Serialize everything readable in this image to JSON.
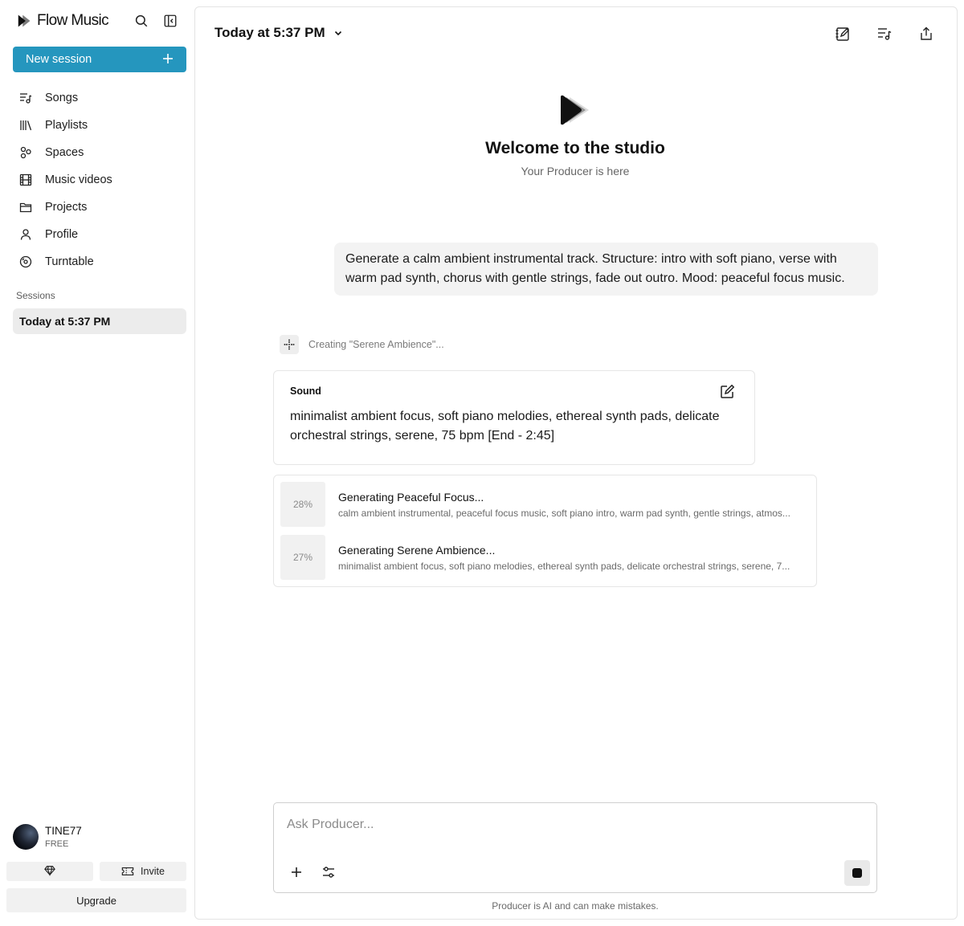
{
  "app": {
    "name": "Flow Music"
  },
  "sidebar": {
    "new_session_label": "New session",
    "new_session_icon": "plus-icon",
    "items": [
      {
        "label": "Songs",
        "icon": "songs-icon"
      },
      {
        "label": "Playlists",
        "icon": "library-icon"
      },
      {
        "label": "Spaces",
        "icon": "spaces-icon"
      },
      {
        "label": "Music videos",
        "icon": "film-icon"
      },
      {
        "label": "Projects",
        "icon": "folder-icon"
      },
      {
        "label": "Profile",
        "icon": "person-icon"
      },
      {
        "label": "Turntable",
        "icon": "vinyl-icon"
      }
    ],
    "sessions_label": "Sessions",
    "sessions": [
      {
        "label": "Today at 5:37 PM",
        "active": true
      }
    ],
    "user": {
      "name": "TINE77",
      "plan": "FREE"
    },
    "invite_label": "Invite",
    "upgrade_label": "Upgrade"
  },
  "header": {
    "session_title": "Today at 5:37 PM",
    "icons": [
      "notes-edit-icon",
      "song-queue-icon",
      "share-icon"
    ]
  },
  "hero": {
    "title": "Welcome to the studio",
    "subtitle": "Your Producer is here"
  },
  "conversation": {
    "user_message": "Generate a calm ambient instrumental track. Structure: intro with soft piano, verse with warm pad synth, chorus with gentle strings, fade out outro. Mood: peaceful focus music.",
    "status_text": "Creating \"Serene Ambience\"...",
    "sound_card": {
      "label": "Sound",
      "text": "minimalist ambient focus, soft piano melodies, ethereal synth pads, delicate orchestral strings, serene, 75 bpm [End - 2:45]"
    },
    "generations": [
      {
        "progress": "28%",
        "title": "Generating Peaceful Focus...",
        "description": "calm ambient instrumental, peaceful focus music, soft piano intro, warm pad synth, gentle strings, atmos..."
      },
      {
        "progress": "27%",
        "title": "Generating Serene Ambience...",
        "description": "minimalist ambient focus, soft piano melodies, ethereal synth pads, delicate orchestral strings, serene, 7..."
      }
    ]
  },
  "composer": {
    "placeholder": "Ask Producer...",
    "value": ""
  },
  "footer": {
    "disclaimer": "Producer is AI and can make mistakes."
  },
  "colors": {
    "accent": "#2596be",
    "active_session_bg": "#ececec"
  }
}
